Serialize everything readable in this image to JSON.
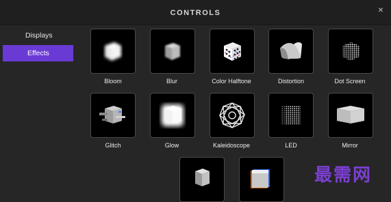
{
  "header": {
    "title": "CONTROLS",
    "close_glyph": "×"
  },
  "sidebar": {
    "items": [
      {
        "label": "Displays",
        "active": false
      },
      {
        "label": "Effects",
        "active": true
      }
    ]
  },
  "effects": [
    {
      "label": "Bloom",
      "icon": "bloom-icon"
    },
    {
      "label": "Blur",
      "icon": "blur-icon"
    },
    {
      "label": "Color Halftone",
      "icon": "color-halftone-icon"
    },
    {
      "label": "Distortion",
      "icon": "distortion-icon"
    },
    {
      "label": "Dot Screen",
      "icon": "dot-screen-icon"
    },
    {
      "label": "Glitch",
      "icon": "glitch-icon"
    },
    {
      "label": "Glow",
      "icon": "glow-icon"
    },
    {
      "label": "Kaleidoscope",
      "icon": "kaleidoscope-icon"
    },
    {
      "label": "LED",
      "icon": "led-icon"
    },
    {
      "label": "Mirror",
      "icon": "mirror-icon"
    },
    {
      "label": "",
      "icon": "cube-icon"
    },
    {
      "label": "",
      "icon": "rgb-shift-icon"
    }
  ],
  "watermark": "最需网",
  "colors": {
    "accent": "#6a3bd4",
    "background": "#262626",
    "tile": "#000000"
  }
}
